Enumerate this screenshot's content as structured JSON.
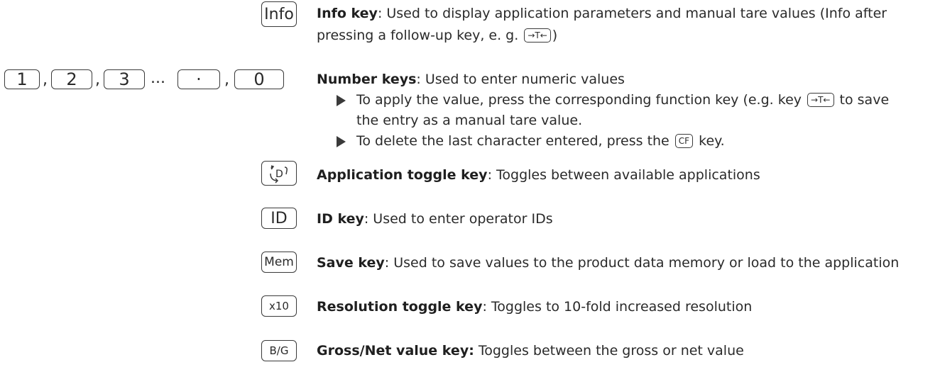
{
  "keys": {
    "info": {
      "label": "Info",
      "title": "Info key",
      "desc": ": Used to display application parameters and manual tare values (Info after",
      "desc2_pre": "pressing a follow-up key, e. g. ",
      "desc2_key": "→T←",
      "desc2_post": ")"
    },
    "numbers": {
      "k1": "1",
      "k2": "2",
      "k3": "3",
      "kdot": "·",
      "k0": "0",
      "sep_comma": ",",
      "sep_ellipsis": "...",
      "title": "Number keys",
      "desc": ": Used to enter numeric values",
      "bullet1_pre": "To apply the value, press the corresponding function key (e.g. key ",
      "bullet1_key": "→T←",
      "bullet1_post": " to save",
      "bullet1_line2": "the entry as a manual tare value.",
      "bullet2_pre": "To delete the last character entered, press the ",
      "bullet2_key": "CF",
      "bullet2_post": " key."
    },
    "app_toggle": {
      "title": "Application toggle key",
      "desc": ": Toggles between available applications"
    },
    "id": {
      "label": "ID",
      "title": "ID key",
      "desc": ": Used to enter operator IDs"
    },
    "mem": {
      "label": "Mem",
      "title": "Save key",
      "desc": ": Used to save values to the product data memory or load to the application"
    },
    "x10": {
      "label": "x10",
      "title": "Resolution toggle key",
      "desc": ": Toggles to 10-fold increased resolution"
    },
    "bg": {
      "label": "B/G",
      "title": "Gross/Net value key:",
      "desc": " Toggles between the gross or net value"
    }
  },
  "colors": {
    "text": "#2a2a2a",
    "border": "#3a3a3a"
  },
  "icons": {
    "app_toggle": "app-toggle-icon",
    "bullet": "triangle-bullet-icon"
  }
}
